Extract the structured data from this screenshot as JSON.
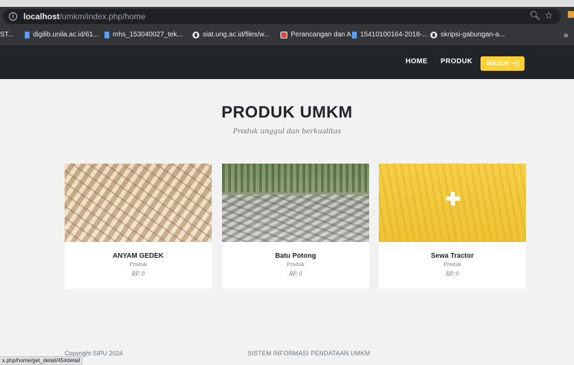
{
  "browser": {
    "url_host": "localhost",
    "url_path": "/umkm/index.php/home",
    "bookmarks": [
      {
        "label": "ST...",
        "icon": "none"
      },
      {
        "label": "digilib.unila.ac.id/61...",
        "icon": "doc-icon"
      },
      {
        "label": "mhs_153040027_tek...",
        "icon": "doc-icon"
      },
      {
        "label": "siat.ung.ac.id/files/w...",
        "icon": "globe-icon"
      },
      {
        "label": "Perancangan dan A...",
        "icon": "pdf-icon"
      },
      {
        "label": "15410100164-2018-...",
        "icon": "doc-icon"
      },
      {
        "label": "skripsi-gabungan-a...",
        "icon": "globe-icon"
      }
    ],
    "more_label": "»",
    "status_url": "x.php/home/get_detail/45#detail"
  },
  "navbar": {
    "home": "HOME",
    "produk": "PRODUK",
    "login": "MASUK ➜]"
  },
  "main": {
    "title": "PRODUK UMKM",
    "subtitle": "Produk unggul dan berkualitas"
  },
  "products": [
    {
      "name": "ANYAM GEDEK",
      "category": "Produk",
      "price": "RP. 0"
    },
    {
      "name": "Batu Potong",
      "category": "Produk",
      "price": "RP. 0"
    },
    {
      "name": "Sewa Tractor",
      "category": "Produk",
      "price": "RP. 0"
    }
  ],
  "footer": {
    "copyright": "Copyright SIPU 2024",
    "system_name": "SISTEM INFORMASI PENDATAAN UMKM"
  },
  "colors": {
    "accent": "#fed136",
    "navbar_bg": "#212529",
    "page_bg": "#f2f2f2"
  }
}
